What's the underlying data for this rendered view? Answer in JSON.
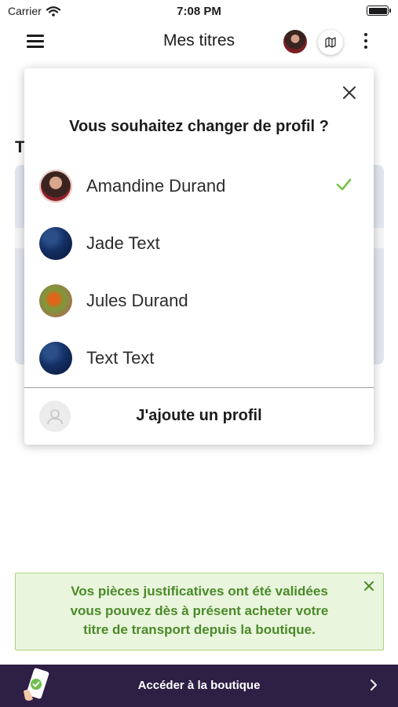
{
  "status_bar": {
    "carrier": "Carrier",
    "time": "7:08 PM",
    "icons": [
      "wifi-icon",
      "battery-icon"
    ]
  },
  "header": {
    "title": "Mes titres",
    "icons": [
      "menu-icon",
      "avatar",
      "map-icon",
      "more-vertical-icon"
    ]
  },
  "background": {
    "heading_peek": "T"
  },
  "profile_modal": {
    "title": "Vous souhaitez changer de profil ?",
    "profiles": [
      {
        "name": "Amandine Durand",
        "selected": true
      },
      {
        "name": "Jade Text",
        "selected": false
      },
      {
        "name": "Jules Durand",
        "selected": false
      },
      {
        "name": "Text Text",
        "selected": false
      }
    ],
    "add_profile_label": "J'ajoute un profil",
    "check_color": "#7cc04a"
  },
  "banner": {
    "line1": "Vos pièces justificatives ont été validées",
    "line2": "vous pouvez dès à présent acheter votre",
    "line3": "titre de transport depuis la boutique.",
    "text_color": "#4a8a2a",
    "background_color": "#eaf5dd"
  },
  "shop_bar": {
    "label": "Accéder à la boutique",
    "background_color": "#2e1f45"
  }
}
